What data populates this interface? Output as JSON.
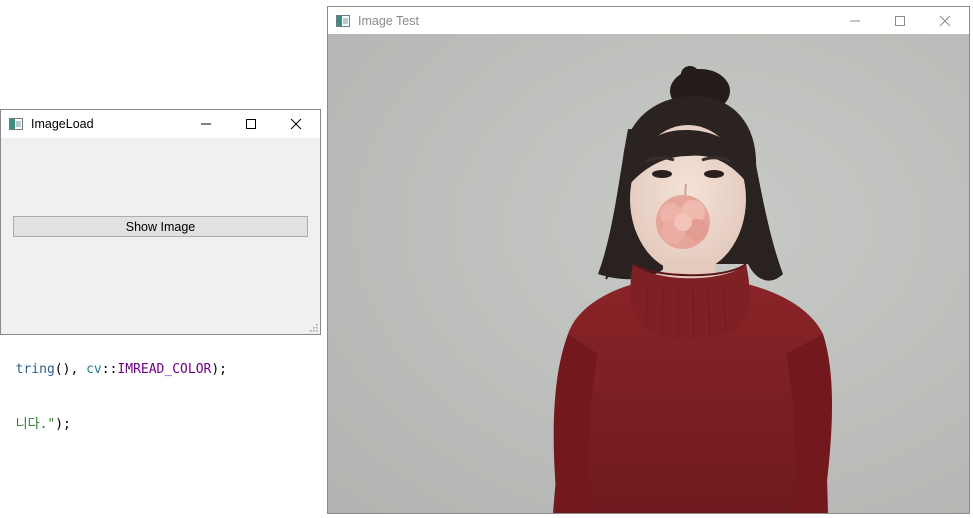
{
  "code_snippet": {
    "line1": {
      "part_a": "tring",
      "part_b": "(), ",
      "part_c": "cv",
      "part_d": "::",
      "part_e": "IMREAD_COLOR",
      "part_f": ");"
    },
    "line2": {
      "part_a": "니다.\"",
      "part_b": ");"
    }
  },
  "imageload_window": {
    "title": "ImageLoad",
    "show_button_label": "Show Image"
  },
  "imagetest_window": {
    "title": "Image Test",
    "content": "photo of a woman in a dark red turtleneck sweater holding a pink carnation in her mouth"
  },
  "colors": {
    "sweater": "#7a1e22",
    "background": "#bfc1be",
    "flower": "#e8a8a0"
  }
}
